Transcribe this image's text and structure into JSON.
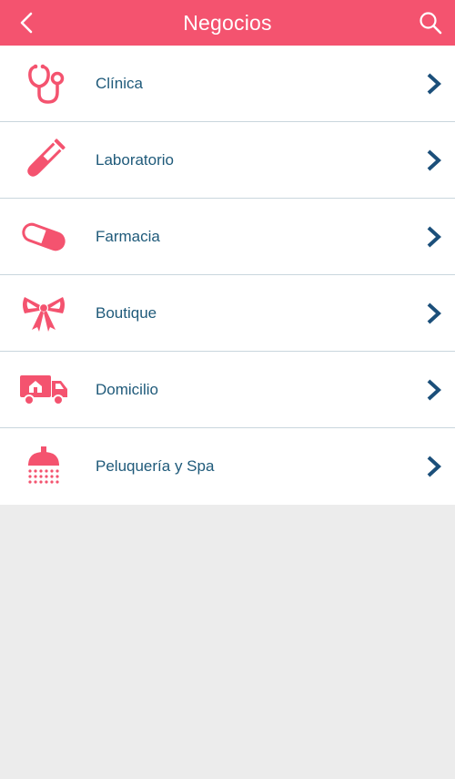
{
  "header": {
    "title": "Negocios",
    "back_icon": "chevron-left-icon",
    "search_icon": "search-icon"
  },
  "colors": {
    "accent": "#f4536f",
    "label": "#1f5a7a",
    "chevron": "#1b4f7a",
    "background": "#ececec"
  },
  "items": [
    {
      "label": "Clínica",
      "icon": "stethoscope-icon"
    },
    {
      "label": "Laboratorio",
      "icon": "test-tube-icon"
    },
    {
      "label": "Farmacia",
      "icon": "pill-icon"
    },
    {
      "label": "Boutique",
      "icon": "bow-icon"
    },
    {
      "label": "Domicilio",
      "icon": "delivery-truck-icon"
    },
    {
      "label": "Peluquería y Spa",
      "icon": "shower-icon"
    }
  ]
}
